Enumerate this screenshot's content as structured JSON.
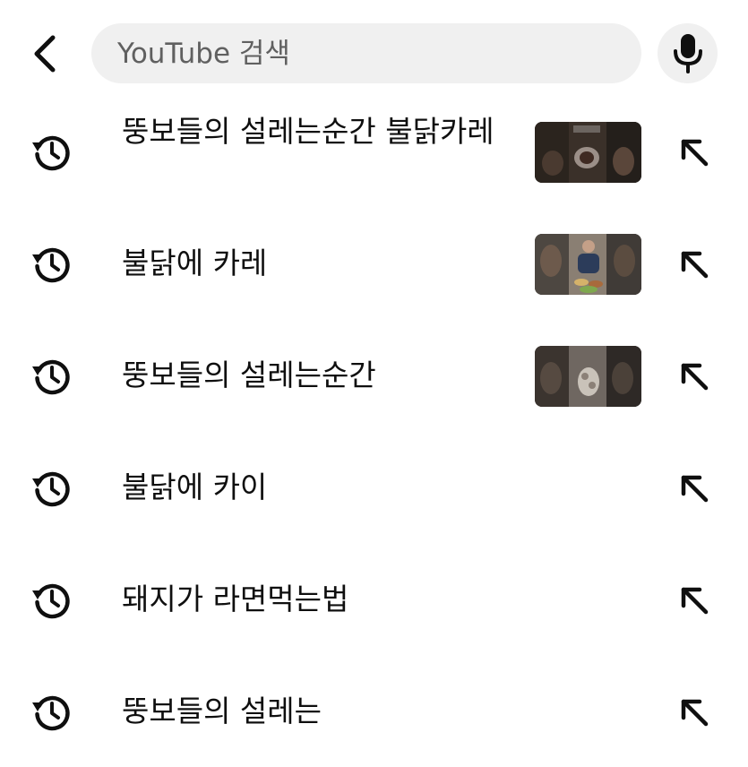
{
  "search": {
    "placeholder": "YouTube 검색",
    "value": ""
  },
  "suggestions": [
    {
      "text": "뚱보들의 설레는순간 불닭카레",
      "has_thumbnail": true
    },
    {
      "text": "불닭에 카레",
      "has_thumbnail": true
    },
    {
      "text": "뚱보들의 설레는순간",
      "has_thumbnail": true
    },
    {
      "text": "불닭에 카이",
      "has_thumbnail": false
    },
    {
      "text": "돼지가 라면먹는법",
      "has_thumbnail": false
    },
    {
      "text": "뚱보들의 설레는",
      "has_thumbnail": false
    }
  ],
  "icons": {
    "back": "back-arrow-icon",
    "mic": "microphone-icon",
    "history": "history-icon",
    "fill_query": "arrow-up-left-icon"
  },
  "colors": {
    "text": "#0f0f0f",
    "placeholder": "#606060",
    "search_background": "#f0f0f0"
  }
}
